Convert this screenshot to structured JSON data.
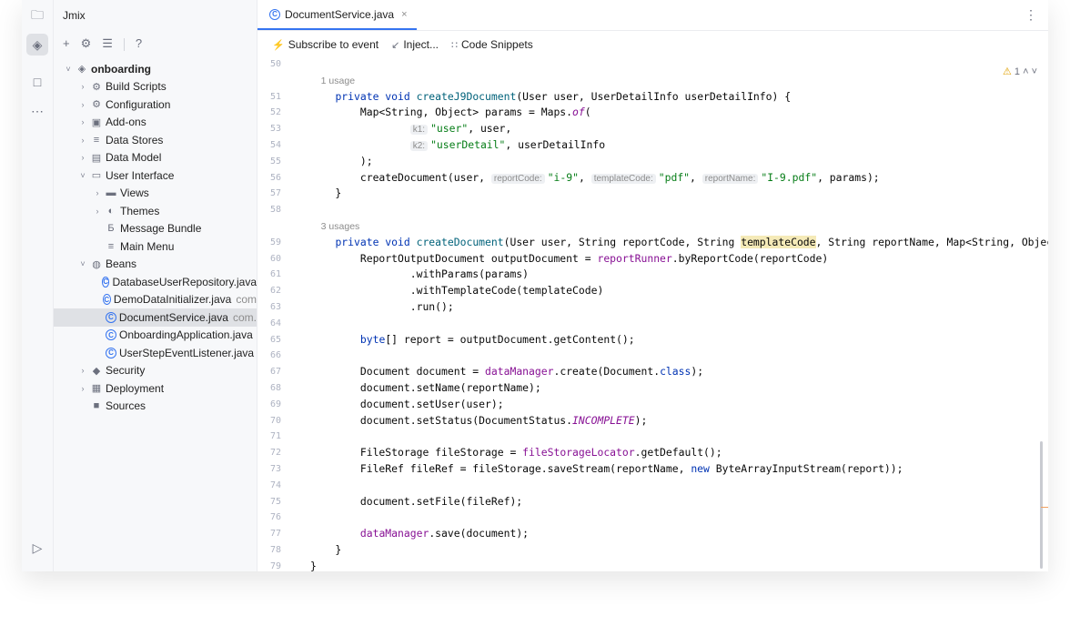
{
  "activity": {
    "icons": [
      "folder-icon",
      "jmix-icon",
      "structure-icon",
      "more-icon",
      "run-icon"
    ]
  },
  "sidebar": {
    "title": "Jmix",
    "tools": [
      "+",
      "⚙",
      "☰",
      "?"
    ]
  },
  "tree": [
    {
      "label": "onboarding",
      "indent": 0,
      "arrow": "˅",
      "icon": "◈",
      "bold": true,
      "kind": "project"
    },
    {
      "label": "Build Scripts",
      "indent": 1,
      "arrow": "›",
      "icon": "⚙",
      "kind": "build"
    },
    {
      "label": "Configuration",
      "indent": 1,
      "arrow": "›",
      "icon": "⚙",
      "kind": "config"
    },
    {
      "label": "Add-ons",
      "indent": 1,
      "arrow": "›",
      "icon": "▣",
      "kind": "addons"
    },
    {
      "label": "Data Stores",
      "indent": 1,
      "arrow": "›",
      "icon": "≡",
      "kind": "datastores"
    },
    {
      "label": "Data Model",
      "indent": 1,
      "arrow": "›",
      "icon": "▤",
      "kind": "datamodel"
    },
    {
      "label": "User Interface",
      "indent": 1,
      "arrow": "˅",
      "icon": "▭",
      "kind": "ui"
    },
    {
      "label": "Views",
      "indent": 2,
      "arrow": "›",
      "icon": "▬",
      "kind": "views"
    },
    {
      "label": "Themes",
      "indent": 2,
      "arrow": "›",
      "icon": "◐",
      "kind": "themes"
    },
    {
      "label": "Message Bundle",
      "indent": 2,
      "arrow": "",
      "icon": "Б",
      "kind": "bundle"
    },
    {
      "label": "Main Menu",
      "indent": 2,
      "arrow": "",
      "icon": "≡",
      "kind": "menu"
    },
    {
      "label": "Beans",
      "indent": 1,
      "arrow": "˅",
      "icon": "◍",
      "kind": "beans"
    },
    {
      "label": "DatabaseUserRepository.java",
      "indent": 2,
      "arrow": "",
      "icon": "C",
      "java": true,
      "kind": "file"
    },
    {
      "label": "DemoDataInitializer.java",
      "suffix": "com",
      "indent": 2,
      "arrow": "",
      "icon": "C",
      "java": true,
      "kind": "file"
    },
    {
      "label": "DocumentService.java",
      "suffix": "com.",
      "indent": 2,
      "arrow": "",
      "icon": "C",
      "java": true,
      "selected": true,
      "kind": "file"
    },
    {
      "label": "OnboardingApplication.java",
      "indent": 2,
      "arrow": "",
      "icon": "C",
      "java": true,
      "kind": "file"
    },
    {
      "label": "UserStepEventListener.java",
      "indent": 2,
      "arrow": "",
      "icon": "C",
      "java": true,
      "kind": "file"
    },
    {
      "label": "Security",
      "indent": 1,
      "arrow": "›",
      "icon": "◆",
      "kind": "security"
    },
    {
      "label": "Deployment",
      "indent": 1,
      "arrow": "›",
      "icon": "▦",
      "kind": "deployment"
    },
    {
      "label": "Sources",
      "indent": 1,
      "arrow": "",
      "icon": "■",
      "kind": "sources"
    }
  ],
  "editor": {
    "tab": {
      "label": "DocumentService.java",
      "close": "×"
    },
    "more": "⋮",
    "hints": [
      {
        "label": "Subscribe to event",
        "icon": "⚡",
        "iconclass": "bolt"
      },
      {
        "label": "Inject...",
        "icon": "↙",
        "iconclass": ""
      },
      {
        "label": "Code Snippets",
        "icon": "∷",
        "iconclass": ""
      }
    ],
    "warnings": {
      "icon": "⚠",
      "count": "1",
      "up": "˄",
      "down": "˅"
    },
    "lines": [
      {
        "num": "50",
        "tokens": []
      },
      {
        "num": "",
        "tokens": [
          [
            "usage",
            "    1 usage"
          ]
        ]
      },
      {
        "num": "51",
        "tokens": [
          [
            "",
            "    "
          ],
          [
            "kw",
            "private void "
          ],
          [
            "fn",
            "createJ9Document"
          ],
          [
            "",
            "(User user, UserDetailInfo userDetailInfo) {"
          ]
        ]
      },
      {
        "num": "52",
        "tokens": [
          [
            "",
            "        Map<String, Object> params = Maps."
          ],
          [
            "ital",
            "of"
          ],
          [
            "",
            "("
          ]
        ]
      },
      {
        "num": "53",
        "tokens": [
          [
            "",
            "                "
          ],
          [
            "inlay",
            "k1:"
          ],
          [
            "str",
            "\"user\""
          ],
          [
            "",
            ", user,"
          ]
        ]
      },
      {
        "num": "54",
        "tokens": [
          [
            "",
            "                "
          ],
          [
            "inlay",
            "k2:"
          ],
          [
            "str",
            "\"userDetail\""
          ],
          [
            "",
            ", userDetailInfo"
          ]
        ]
      },
      {
        "num": "55",
        "tokens": [
          [
            "",
            "        );"
          ]
        ]
      },
      {
        "num": "56",
        "tokens": [
          [
            "",
            "        createDocument(user, "
          ],
          [
            "inlay",
            "reportCode:"
          ],
          [
            "str",
            "\"i-9\""
          ],
          [
            "",
            ", "
          ],
          [
            "inlay",
            "templateCode:"
          ],
          [
            "str",
            "\"pdf\""
          ],
          [
            "",
            ", "
          ],
          [
            "inlay",
            "reportName:"
          ],
          [
            "str",
            "\"I-9.pdf\""
          ],
          [
            "",
            ", params);"
          ]
        ]
      },
      {
        "num": "57",
        "tokens": [
          [
            "",
            "    }"
          ]
        ]
      },
      {
        "num": "58",
        "tokens": []
      },
      {
        "num": "",
        "tokens": [
          [
            "usage",
            "    3 usages"
          ]
        ]
      },
      {
        "num": "59",
        "tokens": [
          [
            "",
            "    "
          ],
          [
            "kw",
            "private void "
          ],
          [
            "fn",
            "createDocument"
          ],
          [
            "",
            "(User user, String reportCode, String "
          ],
          [
            "hl",
            "templateCode"
          ],
          [
            "",
            ", String reportName, Map<String, Object>"
          ]
        ]
      },
      {
        "num": "60",
        "tokens": [
          [
            "",
            "        ReportOutputDocument outputDocument = "
          ],
          [
            "fld",
            "reportRunner"
          ],
          [
            "",
            ".byReportCode(reportCode)"
          ]
        ]
      },
      {
        "num": "61",
        "tokens": [
          [
            "",
            "                .withParams(params)"
          ]
        ]
      },
      {
        "num": "62",
        "tokens": [
          [
            "",
            "                .withTemplateCode(templateCode)"
          ]
        ]
      },
      {
        "num": "63",
        "tokens": [
          [
            "",
            "                .run();"
          ]
        ]
      },
      {
        "num": "64",
        "tokens": []
      },
      {
        "num": "65",
        "tokens": [
          [
            "",
            "        "
          ],
          [
            "kw",
            "byte"
          ],
          [
            "",
            "[] report = outputDocument.getContent();"
          ]
        ]
      },
      {
        "num": "66",
        "tokens": []
      },
      {
        "num": "67",
        "tokens": [
          [
            "",
            "        Document document = "
          ],
          [
            "fld",
            "dataManager"
          ],
          [
            "",
            ".create(Document."
          ],
          [
            "kw",
            "class"
          ],
          [
            "",
            ");"
          ]
        ]
      },
      {
        "num": "68",
        "tokens": [
          [
            "",
            "        document.setName(reportName);"
          ]
        ]
      },
      {
        "num": "69",
        "tokens": [
          [
            "",
            "        document.setUser(user);"
          ]
        ]
      },
      {
        "num": "70",
        "tokens": [
          [
            "",
            "        document.setStatus(DocumentStatus."
          ],
          [
            "ital",
            "INCOMPLETE"
          ],
          [
            "",
            ");"
          ]
        ]
      },
      {
        "num": "71",
        "tokens": []
      },
      {
        "num": "72",
        "tokens": [
          [
            "",
            "        FileStorage fileStorage = "
          ],
          [
            "fld",
            "fileStorageLocator"
          ],
          [
            "",
            ".getDefault();"
          ]
        ]
      },
      {
        "num": "73",
        "tokens": [
          [
            "",
            "        FileRef fileRef = fileStorage.saveStream(reportName, "
          ],
          [
            "kw",
            "new "
          ],
          [
            "",
            "ByteArrayInputStream(report));"
          ]
        ]
      },
      {
        "num": "74",
        "tokens": []
      },
      {
        "num": "75",
        "tokens": [
          [
            "",
            "        document.setFile(fileRef);"
          ]
        ]
      },
      {
        "num": "76",
        "tokens": []
      },
      {
        "num": "77",
        "tokens": [
          [
            "",
            "        "
          ],
          [
            "fld",
            "dataManager"
          ],
          [
            "",
            ".save(document);"
          ]
        ]
      },
      {
        "num": "78",
        "tokens": [
          [
            "",
            "    }"
          ]
        ]
      },
      {
        "num": "79",
        "tokens": [
          [
            "",
            "}"
          ]
        ]
      }
    ]
  }
}
